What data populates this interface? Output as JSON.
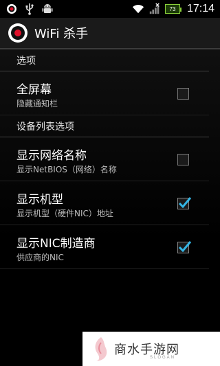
{
  "status_bar": {
    "time": "17:14",
    "battery_label": "73",
    "icons": [
      "record-icon",
      "usb-icon",
      "android-debug-icon",
      "wifi-icon",
      "signal-icon",
      "battery-icon"
    ]
  },
  "app": {
    "title": "WiFi 杀手",
    "accent_color": "#e0102a"
  },
  "sections": {
    "options": {
      "header": "选项",
      "fullscreen": {
        "title": "全屏幕",
        "summary": "隐藏通知栏",
        "checked": false
      }
    },
    "device_list": {
      "header": "设备列表选项",
      "show_network_name": {
        "title": "显示网络名称",
        "summary": "显示NetBIOS（网络）名称",
        "checked": false
      },
      "show_model": {
        "title": "显示机型",
        "summary": "显示机型（硬件NIC）地址",
        "checked": true
      },
      "show_nic_vendor": {
        "title": "显示NIC制造商",
        "summary": "供应商的NIC",
        "checked": true
      }
    }
  },
  "watermark": {
    "text": "商水手游网",
    "sub": "SLOGAN"
  },
  "colors": {
    "check_color": "#33b5e5",
    "battery_color": "#8ad13a"
  }
}
